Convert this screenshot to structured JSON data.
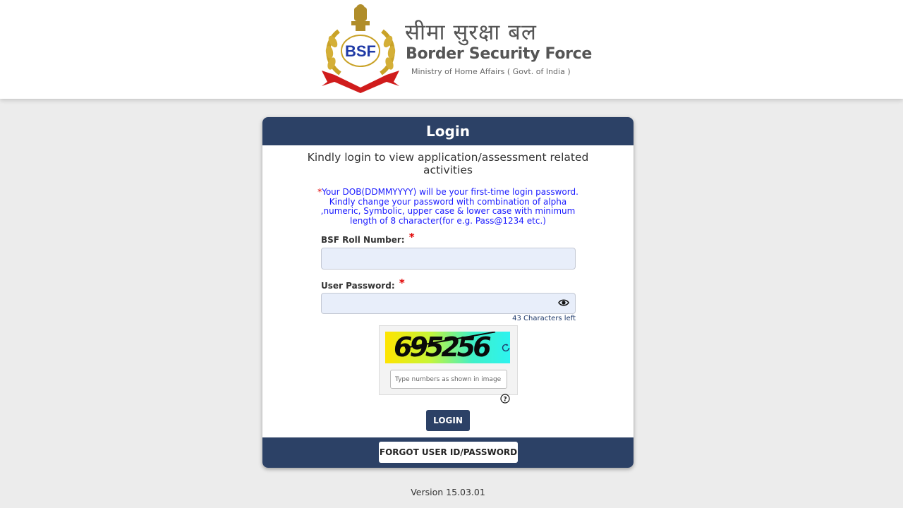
{
  "header": {
    "emblem_text": "BSF",
    "hindi_name": "सीमा सुरक्षा बल",
    "english_name": "Border Security Force",
    "ministry": "Ministry of Home Affairs ( Govt. of India )"
  },
  "login": {
    "title": "Login",
    "subtitle": "Kindly login to view application/assessment related activities",
    "notice_star": "*",
    "notice": "Your DOB(DDMMYYYY) will be your first-time login password. Kindly change your password with combination of alpha ,numeric, Symbolic, upper case & lower case with minimum length of 8 character(for e.g. Pass@1234 etc.)",
    "roll_label": "BSF Roll Number:",
    "roll_value": "",
    "password_label": "User Password:",
    "password_value": "",
    "required_marker": "*",
    "chars_left": "43 Characters left",
    "captcha_code": "695256",
    "captcha_placeholder": "Type numbers as shown in image",
    "captcha_value": "",
    "login_button": "LOGIN",
    "forgot_button": "FORGOT USER ID/PASSWORD"
  },
  "footer": {
    "version": "Version 15.03.01"
  },
  "colors": {
    "primary": "#2c4166",
    "notice_text": "#1a1aff",
    "required": "#e00000",
    "input_bg": "#e8eefa",
    "page_bg": "#ececec"
  },
  "icons": {
    "password_toggle": "eye-icon",
    "captcha_refresh": "refresh-icon",
    "captcha_help": "question-circle-icon",
    "logo": "bsf-emblem-icon"
  }
}
